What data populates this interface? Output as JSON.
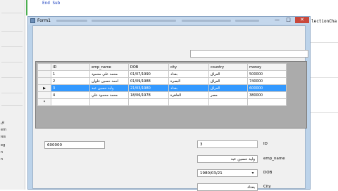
{
  "ide": {
    "code_line": "End Sub",
    "code_tail": "lectionCha",
    "side_items": [
      "اق",
      "em",
      "ies",
      "eg",
      "n",
      "n"
    ]
  },
  "form": {
    "title": "Form1",
    "controls": {
      "minimize": "—",
      "maximize": "□",
      "close": "✕"
    }
  },
  "grid": {
    "columns": [
      "ID",
      "emp_name",
      "DOB",
      "city",
      "country",
      "money"
    ],
    "rows": [
      {
        "id": "1",
        "name": "محمد علي محمود",
        "dob": "01/07/1990",
        "city": "بغداد",
        "country": "العراق",
        "money": "500000",
        "marker": ""
      },
      {
        "id": "2",
        "name": "احمد حسين علوان",
        "dob": "01/09/1988",
        "city": "البصرة",
        "country": "العراق",
        "money": "740000",
        "marker": ""
      },
      {
        "id": "3",
        "name": "وليد حسين عبد",
        "dob": "21/03/1980",
        "city": "بغداد",
        "country": "العراق",
        "money": "600000",
        "marker": "▶"
      },
      {
        "id": "4",
        "name": "محمد محمود علي",
        "dob": "18/06/1978",
        "city": "القاهرة",
        "country": "مصر",
        "money": "380000",
        "marker": ""
      }
    ],
    "new_row_marker": "*"
  },
  "details": {
    "money_value": "600000",
    "id_value": "3",
    "id_label": "ID",
    "name_value": "وليد حسين عبد",
    "name_label": "emp_name",
    "dob_value": "1980/03/21",
    "dob_label": "DOB",
    "city_value": "بغداد",
    "city_label": "City"
  }
}
